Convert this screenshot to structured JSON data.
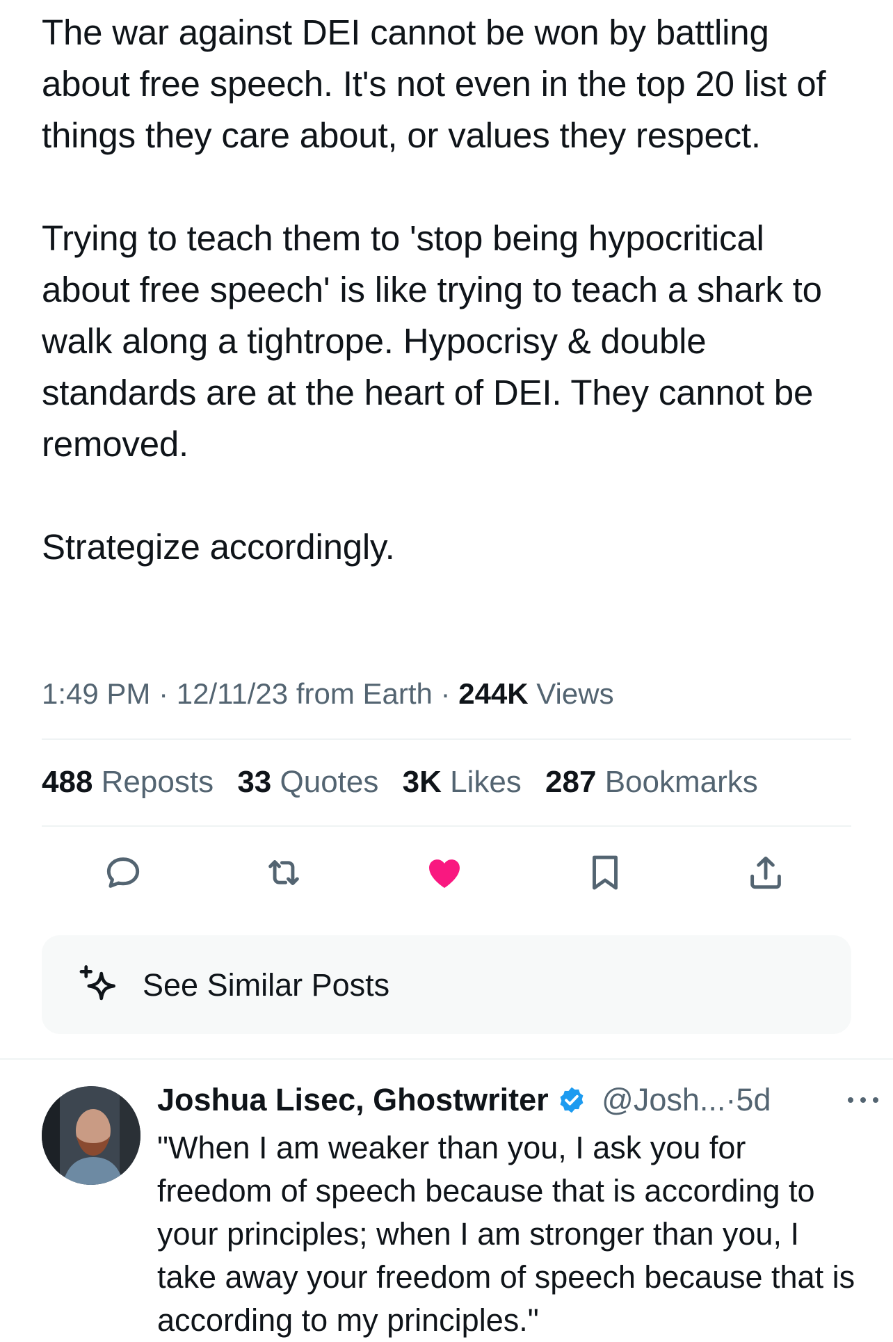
{
  "tweet": {
    "paragraphs": [
      "The war against DEI cannot be won by battling about free speech. It's not even in the top 20 list of things they care about, or values they respect.",
      "Trying to teach them to 'stop being hypocritical about free speech' is like trying to teach a shark to walk along a tightrope. Hypocrisy & double standards are at the heart of DEI. They cannot be removed.",
      "Strategize accordingly."
    ],
    "time": "1:49 PM",
    "date": "12/11/23",
    "source": "from Earth",
    "separator": "·",
    "views_count": "244K",
    "views_label": "Views"
  },
  "stats": {
    "reposts": {
      "count": "488",
      "label": "Reposts"
    },
    "quotes": {
      "count": "33",
      "label": "Quotes"
    },
    "likes": {
      "count": "3K",
      "label": "Likes"
    },
    "bookmarks": {
      "count": "287",
      "label": "Bookmarks"
    }
  },
  "actions": {
    "icons": [
      "reply-icon",
      "repost-icon",
      "like-icon",
      "bookmark-icon",
      "share-icon"
    ],
    "like_active_color": "#f91880",
    "icon_color": "#536471"
  },
  "similar": {
    "label": "See Similar Posts",
    "icon": "sparkle-icon"
  },
  "reply": {
    "name": "Joshua Lisec, Ghostwriter",
    "verified_color": "#1d9bf0",
    "handle": "@Josh...",
    "separator": "·",
    "time": "5d",
    "text": "\"When I am weaker than you, I ask you for freedom of speech because that is according to your principles; when I am stronger than you, I take away your freedom of speech because that is according to my principles.\""
  }
}
